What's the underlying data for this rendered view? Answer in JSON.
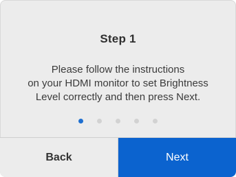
{
  "dialog": {
    "title": "Step 1",
    "message_lines": [
      "Please follow the instructions",
      "on your HDMI monitor to set Brightness",
      "Level correctly and then press Next."
    ],
    "pager": {
      "total": 5,
      "current": 1
    },
    "buttons": {
      "back": "Back",
      "next": "Next"
    },
    "colors": {
      "accent": "#0b63cf",
      "background": "#ececec",
      "dot_active": "#1e6fd0",
      "dot_inactive": "#d2d2d2"
    }
  }
}
